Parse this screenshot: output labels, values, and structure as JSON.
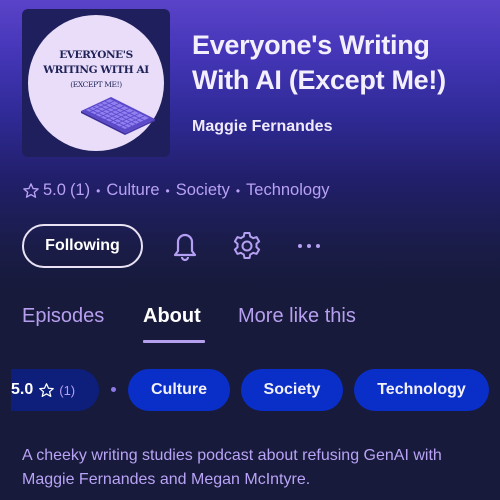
{
  "podcast": {
    "cover_art": {
      "line1": "EVERYONE'S",
      "line2": "WRITING WITH AI",
      "line3": "(EXCEPT ME!)",
      "image": "keyboard-illustration"
    },
    "title": "Everyone's Writing With AI (Except Me!)",
    "author": "Maggie Fernandes"
  },
  "meta": {
    "rating_icon": "star-outline-icon",
    "rating": "5.0",
    "rating_count": "(1)",
    "separator": "•",
    "categories": [
      "Culture",
      "Society",
      "Technology"
    ]
  },
  "actions": {
    "follow_label": "Following",
    "notifications_icon": "bell-icon",
    "settings_icon": "gear-icon",
    "more_icon": "ellipsis-icon",
    "more_label": "···"
  },
  "tabs": [
    {
      "label": "Episodes",
      "active": false
    },
    {
      "label": "About",
      "active": true
    },
    {
      "label": "More like this",
      "active": false
    }
  ],
  "chips": {
    "rating": "5.0",
    "rating_count": "(1)",
    "categories": [
      "Culture",
      "Society",
      "Technology"
    ]
  },
  "about": {
    "description": "A cheeky writing studies podcast about refusing GenAI with Maggie Fernandes and Megan McIntyre."
  },
  "colors": {
    "accent_purple": "#b79ff0",
    "chip_blue": "#0a2fc8",
    "background": "#171a3a",
    "hero_top": "#5a43c8"
  }
}
